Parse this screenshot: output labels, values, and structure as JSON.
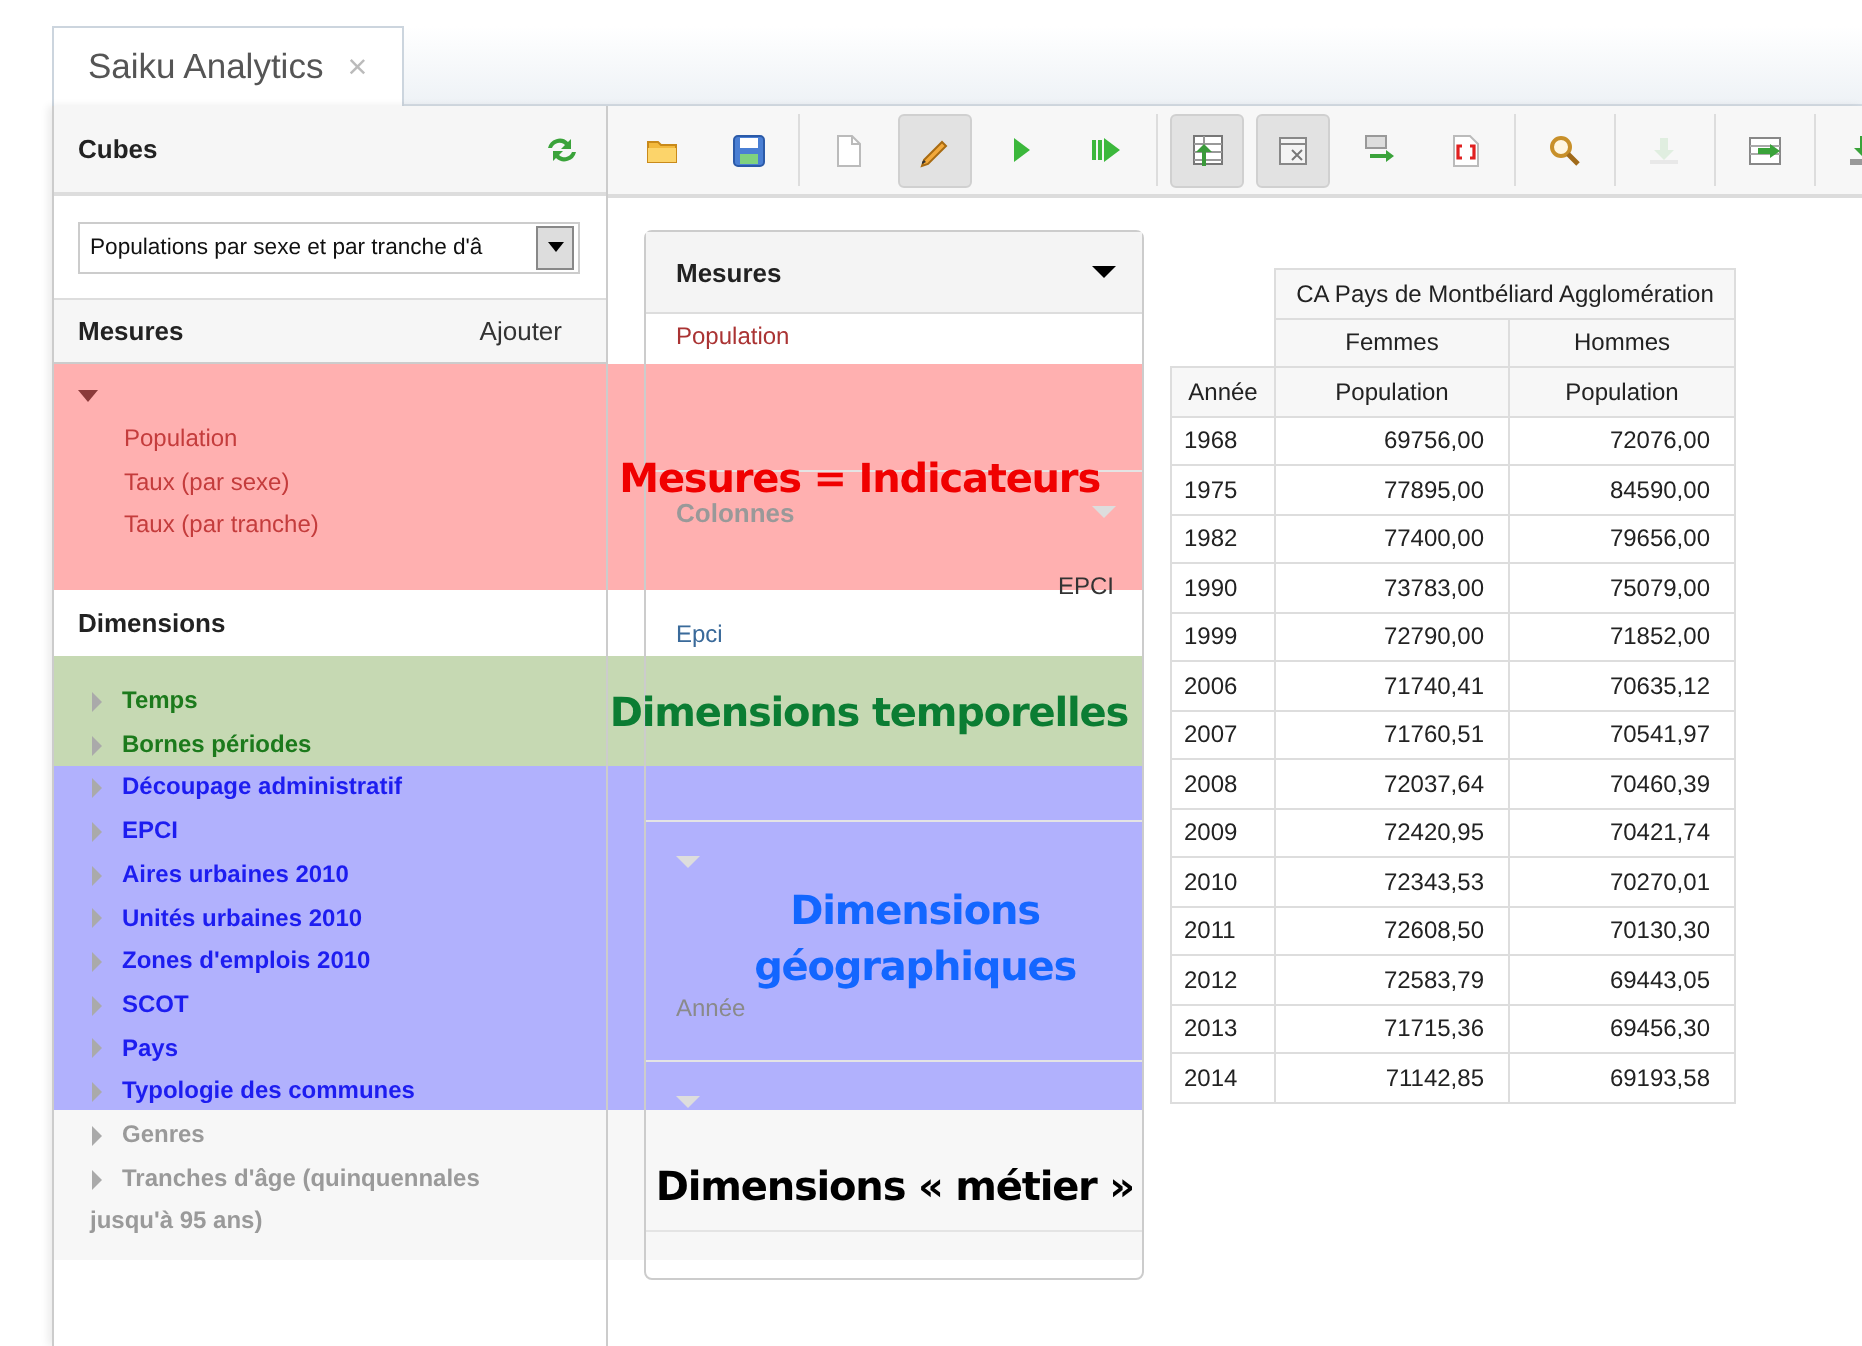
{
  "tabs": [
    {
      "label": "Saiku Analytics",
      "close": "×",
      "selected": true
    }
  ],
  "sidebar": {
    "cubes_title": "Cubes",
    "cube_select": {
      "value": "Populations par sexe et par tranche d'â"
    },
    "measures_title": "Mesures",
    "add_label": "Ajouter",
    "measures": {
      "expanded": true,
      "items": [
        "Population",
        "Taux (par sexe)",
        "Taux (par tranche)"
      ]
    },
    "dimensions_title": "Dimensions",
    "dimension_groups": [
      {
        "kind": "temporal",
        "items": [
          {
            "label": "Temps",
            "expanded": false
          },
          {
            "label": "Bornes périodes",
            "expanded": false
          }
        ]
      },
      {
        "kind": "geographic",
        "items": [
          {
            "label": "Découpage administratif",
            "expanded": false
          },
          {
            "label": "EPCI",
            "expanded": false
          },
          {
            "label": "Aires urbaines 2010",
            "expanded": false
          },
          {
            "label": "Unités urbaines 2010",
            "expanded": false
          },
          {
            "label": "Zones d'emplois 2010",
            "expanded": false
          },
          {
            "label": "SCOT",
            "expanded": false
          },
          {
            "label": "Pays",
            "expanded": false
          },
          {
            "label": "Typologie des communes",
            "expanded": false
          }
        ]
      },
      {
        "kind": "business",
        "items": [
          {
            "label": "Genres",
            "expanded": false
          },
          {
            "label": "Tranches d'âge (quinquennales jusqu'à 95 ans)",
            "expanded": false
          }
        ]
      }
    ]
  },
  "toolbar": {
    "groups": [
      {
        "buttons": [
          {
            "kind": "open",
            "pressed": false,
            "disabled": false
          },
          {
            "kind": "save",
            "pressed": false,
            "disabled": false
          }
        ]
      },
      {
        "buttons": [
          {
            "kind": "new",
            "pressed": false,
            "disabled": false
          },
          {
            "kind": "edit",
            "pressed": true,
            "disabled": false
          },
          {
            "kind": "run",
            "pressed": false,
            "disabled": false
          },
          {
            "kind": "auto",
            "pressed": false,
            "disabled": false
          }
        ]
      },
      {
        "buttons": [
          {
            "kind": "non-empty",
            "pressed": true,
            "disabled": false
          },
          {
            "kind": "hide",
            "pressed": true,
            "disabled": false
          },
          {
            "kind": "swap",
            "pressed": false,
            "disabled": false
          },
          {
            "kind": "mdx",
            "pressed": false,
            "disabled": false
          }
        ]
      },
      {
        "buttons": [
          {
            "kind": "search",
            "pressed": false,
            "disabled": false
          }
        ]
      },
      {
        "buttons": [
          {
            "kind": "drill",
            "pressed": false,
            "disabled": true
          }
        ]
      },
      {
        "buttons": [
          {
            "kind": "export",
            "pressed": false,
            "disabled": false
          }
        ]
      },
      {
        "buttons": [
          {
            "kind": "download",
            "pressed": false,
            "disabled": false
          }
        ]
      }
    ]
  },
  "query": {
    "sections": [
      {
        "kind": "measures",
        "title": "Mesures",
        "items": [
          "Population"
        ]
      },
      {
        "kind": "columns",
        "title": "Colonnes",
        "level": "EPCI",
        "items": [
          "Epci"
        ]
      },
      {
        "kind": "rows",
        "items": [
          "Année"
        ]
      },
      {
        "kind": "filter"
      }
    ]
  },
  "table": {
    "column_header": "CA Pays de Montbéliard Agglomération",
    "column_members": [
      "Femmes",
      "Hommes"
    ],
    "row_header": "Année",
    "measure_headers": [
      "Population",
      "Population"
    ],
    "rows": [
      [
        "1968",
        "69756,00",
        "72076,00"
      ],
      [
        "1975",
        "77895,00",
        "84590,00"
      ],
      [
        "1982",
        "77400,00",
        "79656,00"
      ],
      [
        "1990",
        "73783,00",
        "75079,00"
      ],
      [
        "1999",
        "72790,00",
        "71852,00"
      ],
      [
        "2006",
        "71740,41",
        "70635,12"
      ],
      [
        "2007",
        "71760,51",
        "70541,97"
      ],
      [
        "2008",
        "72037,64",
        "70460,39"
      ],
      [
        "2009",
        "72420,95",
        "70421,74"
      ],
      [
        "2010",
        "72343,53",
        "70270,01"
      ],
      [
        "2011",
        "72608,50",
        "70130,30"
      ],
      [
        "2012",
        "72583,79",
        "69443,05"
      ],
      [
        "2013",
        "71715,36",
        "69456,30"
      ],
      [
        "2014",
        "71142,85",
        "69193,58"
      ]
    ]
  },
  "annotations": [
    {
      "kind": "measures",
      "label": "Mesures = Indicateurs"
    },
    {
      "kind": "temporal",
      "label": "Dimensions temporelles"
    },
    {
      "kind": "geographic",
      "label": "Dimensions géographiques"
    },
    {
      "kind": "business",
      "label": "Dimensions « métier »"
    }
  ]
}
